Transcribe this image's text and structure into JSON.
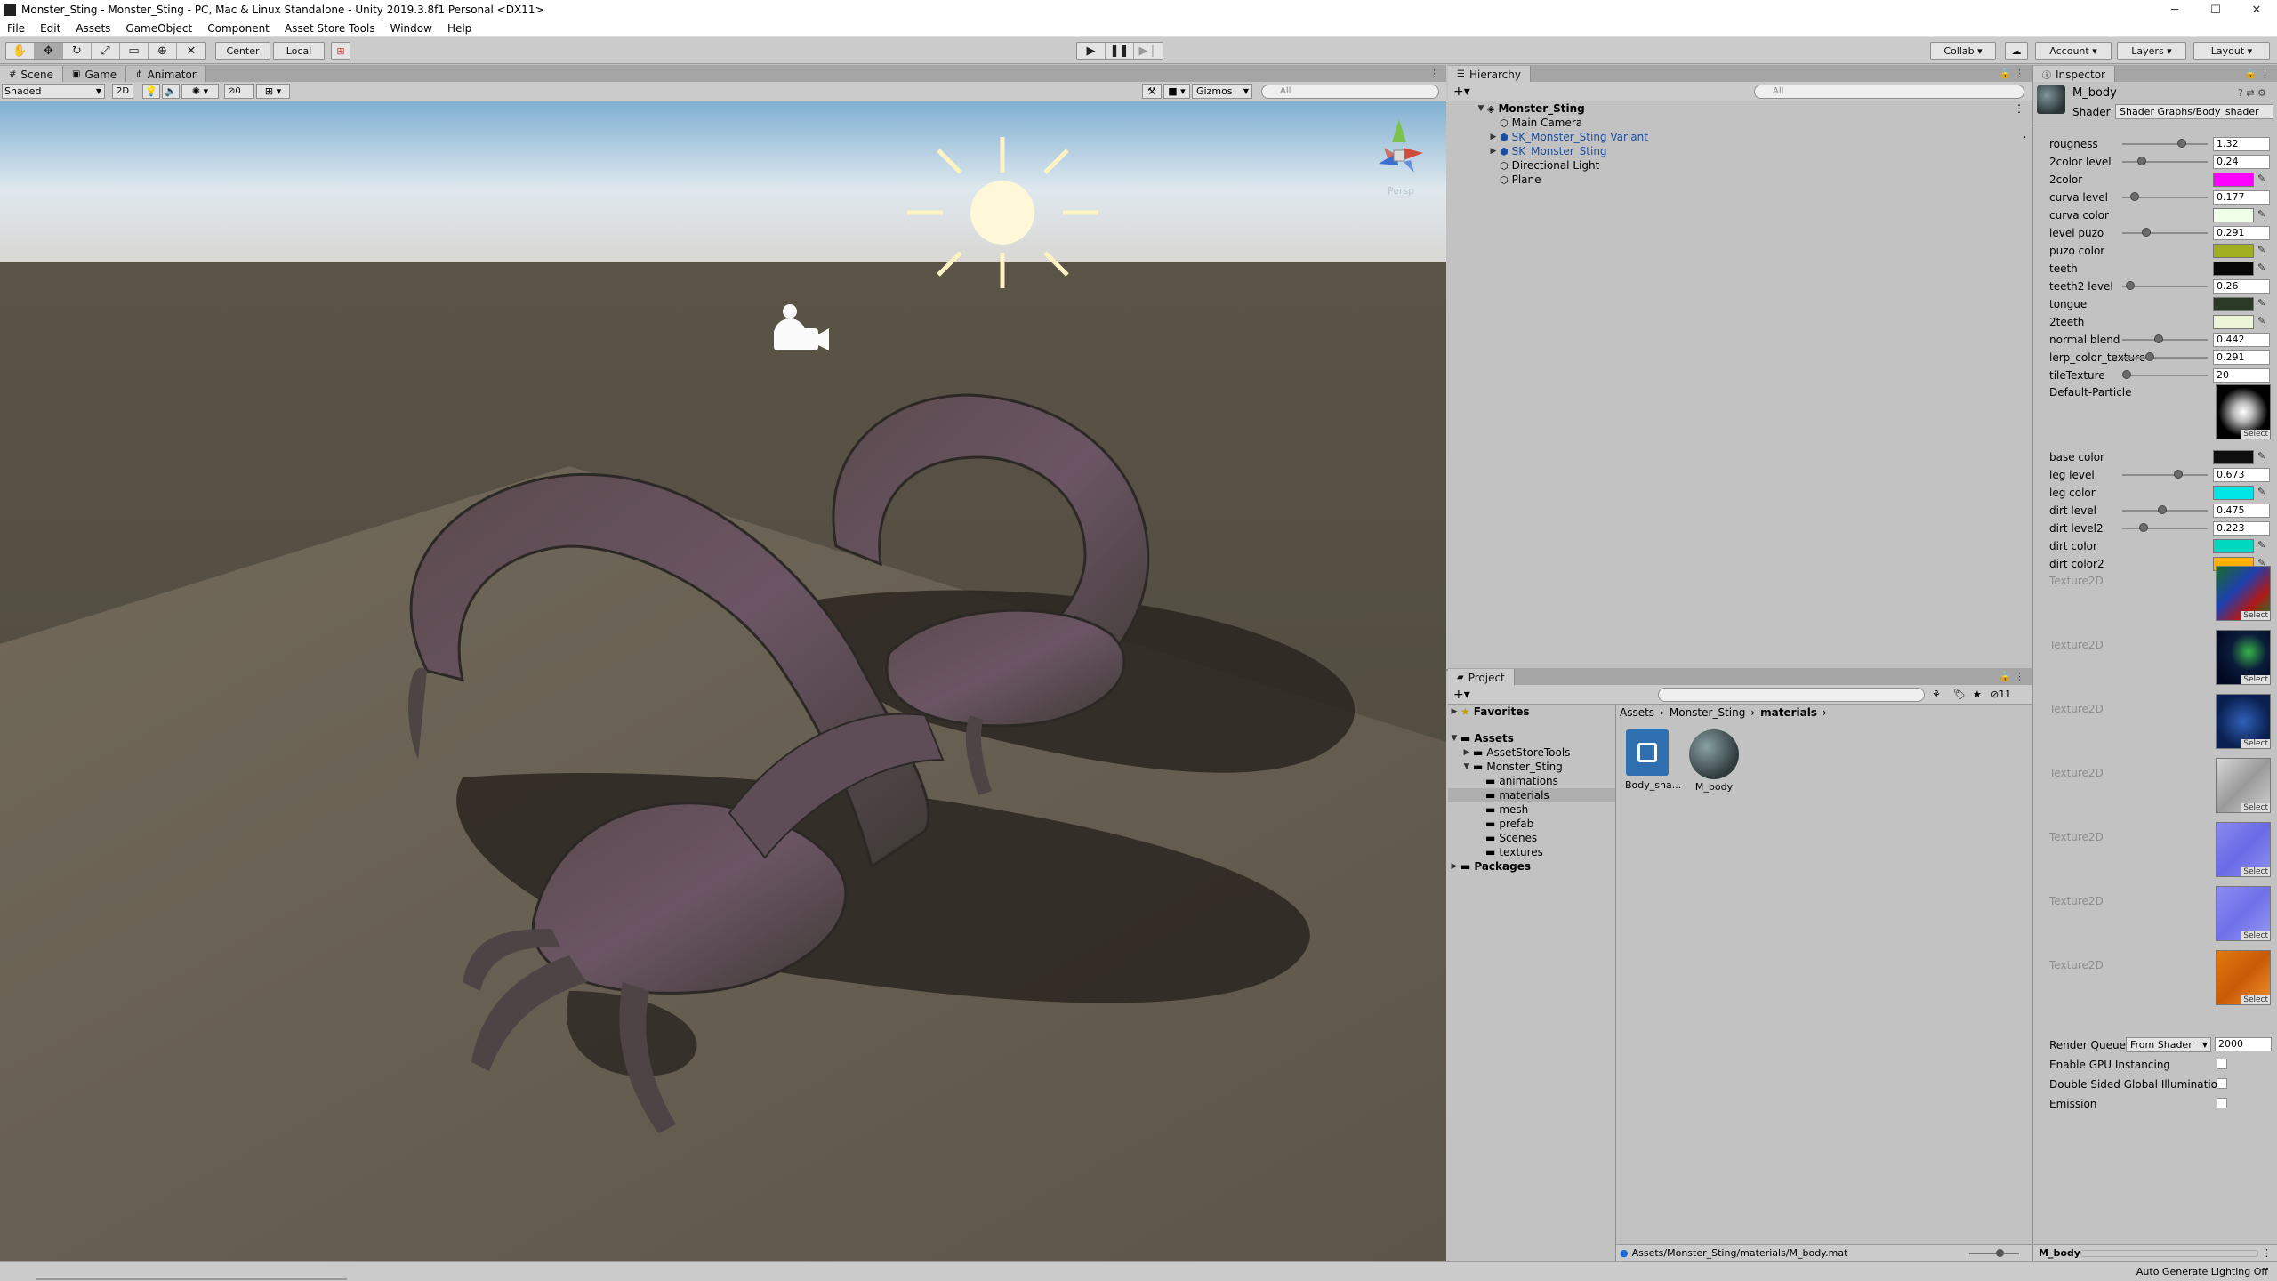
{
  "window": {
    "title": "Monster_Sting - Monster_Sting - PC, Mac & Linux Standalone - Unity 2019.3.8f1 Personal <DX11>",
    "minimize": "─",
    "maximize": "☐",
    "close": "✕"
  },
  "menu": [
    "File",
    "Edit",
    "Assets",
    "GameObject",
    "Component",
    "Asset Store Tools",
    "Window",
    "Help"
  ],
  "toolbar": {
    "center": "Center",
    "local": "Local",
    "collab": "Collab ▾",
    "account": "Account ▾",
    "layers": "Layers ▾",
    "layout": "Layout ▾"
  },
  "scene": {
    "tabs": [
      "Scene",
      "Game",
      "Animator"
    ],
    "shading": "Shaded",
    "mode_2d": "2D",
    "hidden_count": "0",
    "gizmos": "Gizmos",
    "search_placeholder": "All",
    "persp": "Persp"
  },
  "hierarchy": {
    "tab": "Hierarchy",
    "search_placeholder": "All",
    "root": "Monster_Sting",
    "items": [
      "Main Camera",
      "SK_Monster_Sting Variant",
      "SK_Monster_Sting",
      "Directional Light",
      "Plane"
    ]
  },
  "project": {
    "tab": "Project",
    "hidden_count": "11",
    "favorites": "Favorites",
    "assets": "Assets",
    "asset_folders": [
      "AssetStoreTools",
      "Monster_Sting"
    ],
    "sting_folders": [
      "animations",
      "materials",
      "mesh",
      "prefab",
      "Scenes",
      "textures"
    ],
    "packages": "Packages",
    "breadcrumb": [
      "Assets",
      "Monster_Sting",
      "materials"
    ],
    "files": [
      "Body_sha...",
      "M_body"
    ],
    "status_path": "Assets/Monster_Sting/materials/M_body.mat"
  },
  "inspector": {
    "tab": "Inspector",
    "name": "M_body",
    "shader_label": "Shader",
    "shader_value": "Shader Graphs/Body_shader",
    "properties": [
      {
        "label": "rougness",
        "kind": "slider",
        "value": "1.32",
        "pos": 0.72
      },
      {
        "label": "2color level",
        "kind": "slider",
        "value": "0.24",
        "pos": 0.2
      },
      {
        "label": "2color",
        "kind": "color",
        "color": "#ff00ff"
      },
      {
        "label": "curva level",
        "kind": "slider",
        "value": "0.177",
        "pos": 0.1
      },
      {
        "label": "curva color",
        "kind": "color",
        "color": "#f0ffe8"
      },
      {
        "label": "level puzo",
        "kind": "slider",
        "value": "0.291",
        "pos": 0.25
      },
      {
        "label": "puzo color",
        "kind": "color",
        "color": "#a0b020"
      },
      {
        "label": "teeth",
        "kind": "color",
        "color": "#080808"
      },
      {
        "label": "teeth2 level",
        "kind": "slider",
        "value": "0.26",
        "pos": 0.05
      },
      {
        "label": "tongue",
        "kind": "color",
        "color": "#2a3a26"
      },
      {
        "label": "2teeth",
        "kind": "color",
        "color": "#ecf6d6"
      },
      {
        "label": "normal blend",
        "kind": "slider",
        "value": "0.442",
        "pos": 0.42
      },
      {
        "label": "lerp_color_texture",
        "kind": "slider",
        "value": "0.291",
        "pos": 0.3
      },
      {
        "label": "tileTexture",
        "kind": "slider",
        "value": "20",
        "pos": 0.0
      }
    ],
    "default_particle": "Default-Particle",
    "select": "Select",
    "properties2": [
      {
        "label": "base color",
        "kind": "color",
        "color": "#101010"
      },
      {
        "label": "leg level",
        "kind": "slider",
        "value": "0.673",
        "pos": 0.67
      },
      {
        "label": "leg color",
        "kind": "color",
        "color": "#00e6e6"
      },
      {
        "label": "dirt level",
        "kind": "slider",
        "value": "0.475",
        "pos": 0.47
      },
      {
        "label": "dirt level2",
        "kind": "slider",
        "value": "0.223",
        "pos": 0.22
      },
      {
        "label": "dirt color",
        "kind": "color",
        "color": "#00d8c0"
      },
      {
        "label": "dirt color2",
        "kind": "color",
        "color": "#ffb000"
      }
    ],
    "textures": [
      "Texture2D",
      "Texture2D",
      "Texture2D",
      "Texture2D",
      "Texture2D",
      "Texture2D",
      "Texture2D"
    ],
    "render_queue_label": "Render Queue",
    "render_queue_mode": "From Shader",
    "render_queue_value": "2000",
    "toggles": [
      "Enable GPU Instancing",
      "Double Sided Global Illumination",
      "Emission"
    ],
    "footer_name": "M_body"
  },
  "status": {
    "right": "Auto Generate Lighting Off"
  }
}
